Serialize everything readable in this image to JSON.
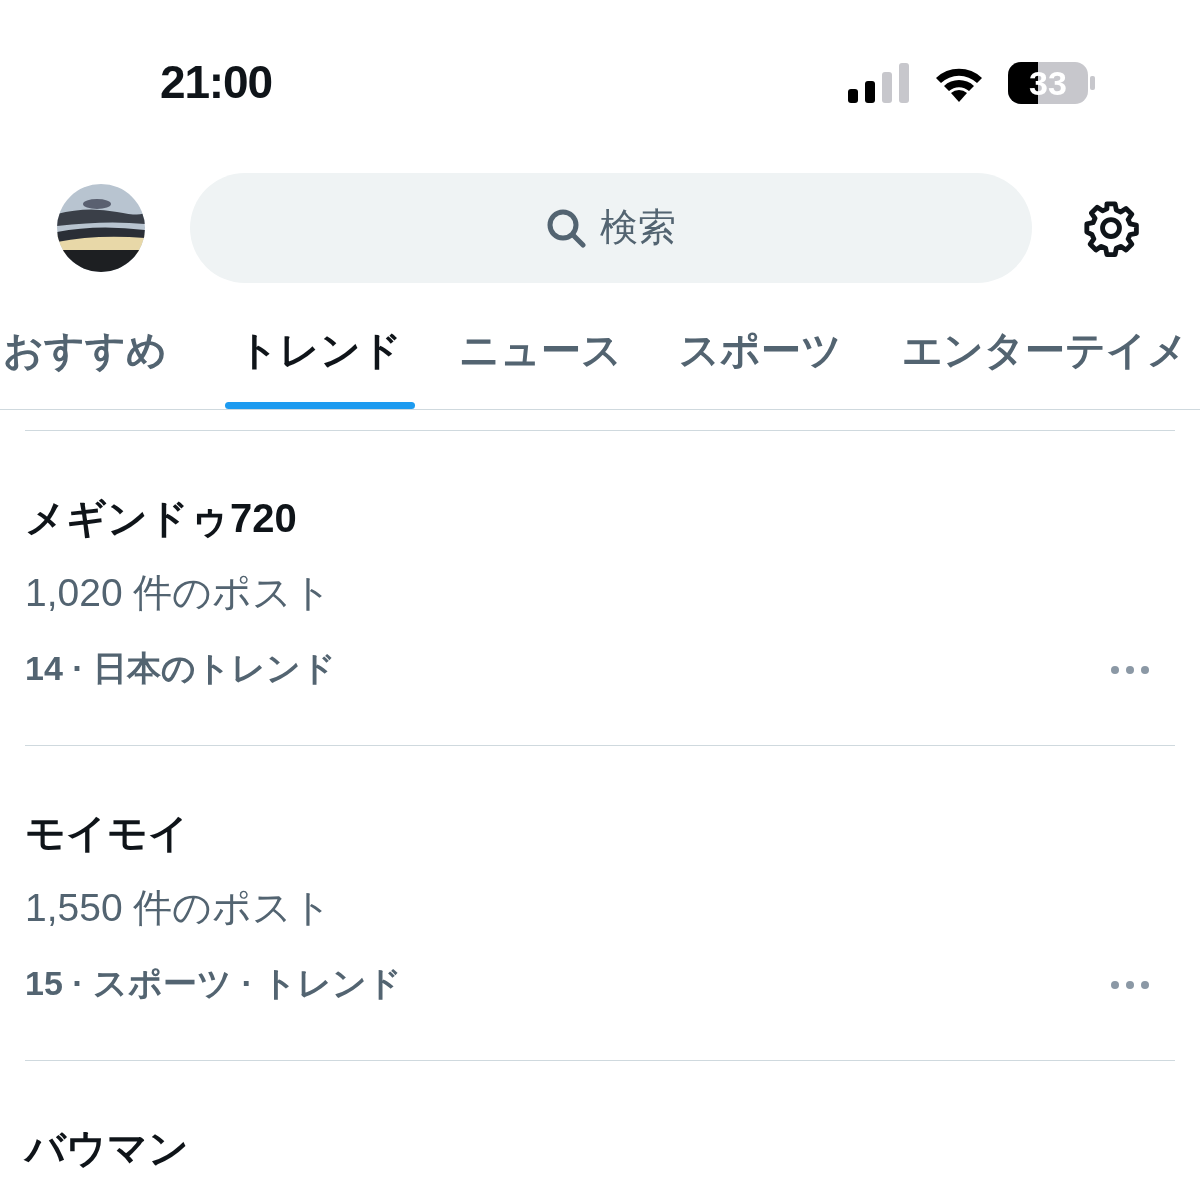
{
  "status_bar": {
    "time": "21:00",
    "battery": "33"
  },
  "search": {
    "placeholder": "検索"
  },
  "tabs": [
    {
      "label": "おすすめ",
      "selected": false
    },
    {
      "label": "トレンド",
      "selected": true
    },
    {
      "label": "ニュース",
      "selected": false
    },
    {
      "label": "スポーツ",
      "selected": false
    },
    {
      "label": "エンターテイメ",
      "selected": false
    }
  ],
  "trends": [
    {
      "title": "メギンドゥ720",
      "posts": "1,020 件のポスト",
      "meta": "14 · 日本のトレンド"
    },
    {
      "title": "モイモイ",
      "posts": "1,550 件のポスト",
      "meta": "15 · スポーツ · トレンド"
    },
    {
      "title": "バウマン"
    }
  ]
}
